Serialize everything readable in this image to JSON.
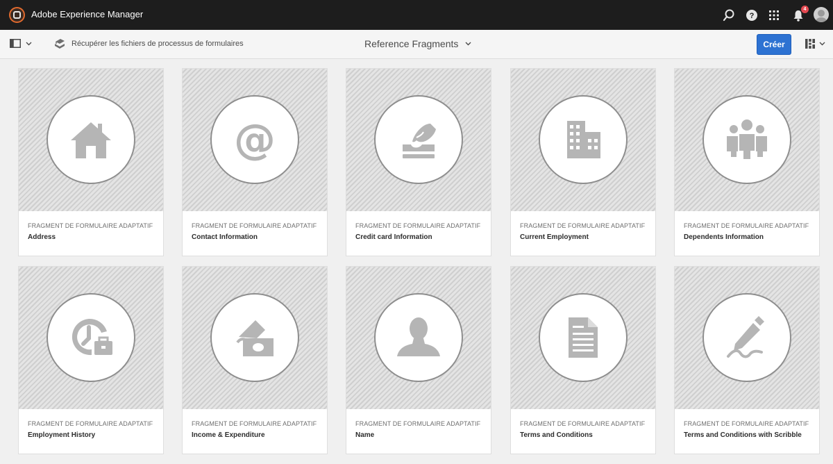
{
  "shell": {
    "app_name": "Adobe Experience Manager",
    "notification_count": "4",
    "icons": [
      "adobe-logo-icon",
      "search-icon",
      "help-icon",
      "apps-grid-icon",
      "bell-icon",
      "user-avatar"
    ]
  },
  "actionbar": {
    "process_label": "Récupérer les fichiers de processus de formulaires",
    "page_title": "Reference Fragments",
    "create_label": "Créer"
  },
  "colors": {
    "shell_bg": "#1d1d1d",
    "accent": "#2d72d2",
    "badge": "#e34850",
    "logo": "#e06a2e"
  },
  "cards": [
    {
      "type": "FRAGMENT DE FORMULAIRE ADAPTATIF",
      "title": "Address",
      "icon": "house-icon"
    },
    {
      "type": "FRAGMENT DE FORMULAIRE ADAPTATIF",
      "title": "Contact Information",
      "icon": "at-sign-icon"
    },
    {
      "type": "FRAGMENT DE FORMULAIRE ADAPTATIF",
      "title": "Credit card Information",
      "icon": "credit-card-icon"
    },
    {
      "type": "FRAGMENT DE FORMULAIRE ADAPTATIF",
      "title": "Current Employment",
      "icon": "building-icon"
    },
    {
      "type": "FRAGMENT DE FORMULAIRE ADAPTATIF",
      "title": "Dependents Information",
      "icon": "people-group-icon"
    },
    {
      "type": "FRAGMENT DE FORMULAIRE ADAPTATIF",
      "title": "Employment History",
      "icon": "clock-briefcase-icon"
    },
    {
      "type": "FRAGMENT DE FORMULAIRE ADAPTATIF",
      "title": "Income & Expenditure",
      "icon": "money-icon"
    },
    {
      "type": "FRAGMENT DE FORMULAIRE ADAPTATIF",
      "title": "Name",
      "icon": "person-icon"
    },
    {
      "type": "FRAGMENT DE FORMULAIRE ADAPTATIF",
      "title": "Terms and Conditions",
      "icon": "document-icon"
    },
    {
      "type": "FRAGMENT DE FORMULAIRE ADAPTATIF",
      "title": "Terms and Conditions with Scribble",
      "icon": "pen-scribble-icon"
    }
  ]
}
